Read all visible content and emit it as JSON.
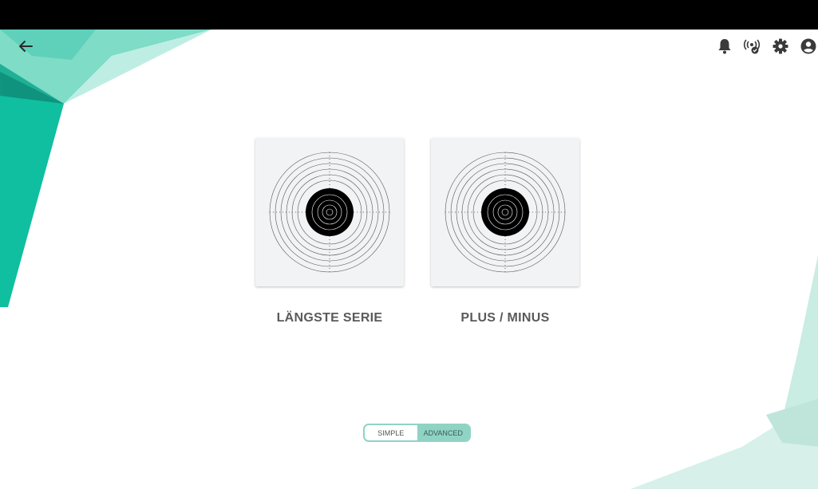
{
  "header": {
    "back_icon": "arrow-left-icon",
    "icons": [
      "bell-icon",
      "broadcast-icon",
      "gear-icon",
      "account-icon"
    ]
  },
  "games": [
    {
      "label": "LÄNGSTE SERIE",
      "icon": "target-icon"
    },
    {
      "label": "PLUS / MINUS",
      "icon": "target-icon"
    }
  ],
  "mode_toggle": {
    "options": [
      "SIMPLE",
      "ADVANCED"
    ],
    "selected": "ADVANCED"
  },
  "colors": {
    "accent": "#8fd3c5",
    "teal_dark": "#16a58e",
    "teal_mid": "#2dc3a6",
    "teal_light": "#c9ece3",
    "card_bg": "#f2f3f5"
  }
}
